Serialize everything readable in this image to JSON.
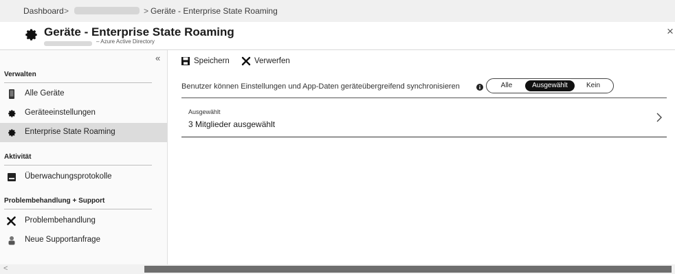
{
  "breadcrumb": {
    "dashboard": "Dashboard",
    "separator": ">",
    "current": "Geräte - Enterprise State Roaming"
  },
  "header": {
    "title": "Geräte - Enterprise State Roaming",
    "subtitle": "– Azure Active Directory",
    "icon": "gear-icon",
    "close": "×"
  },
  "sidebar": {
    "collapse": "«",
    "groups": [
      {
        "title": "Verwalten"
      },
      {
        "title": "Aktivität"
      },
      {
        "title": "Problembehandlung + Support"
      }
    ],
    "items": [
      {
        "label": "Alle Geräte",
        "icon": "device-icon"
      },
      {
        "label": "Geräteeinstellungen",
        "icon": "gear-icon"
      },
      {
        "label": "Enterprise State Roaming",
        "icon": "gear-icon",
        "active": true
      },
      {
        "label": "Überwachungsprotokolle",
        "icon": "log-icon"
      },
      {
        "label": "Problembehandlung",
        "icon": "tools-icon"
      },
      {
        "label": "Neue Supportanfrage",
        "icon": "support-person-icon"
      }
    ]
  },
  "toolbar": {
    "save_label": "Speichern",
    "discard_label": "Verwerfen"
  },
  "sync_setting": {
    "label": "Benutzer können Einstellungen und App-Daten geräteübergreifend synchronisieren",
    "options": [
      "Alle",
      "Ausgewählt",
      "Kein"
    ],
    "selected": "Ausgewählt"
  },
  "selected_members": {
    "caption": "Ausgewählt",
    "value": "3 Mitglieder ausgewählt"
  },
  "colors": {
    "accent": "#111111",
    "active_nav": "#dcdcdc",
    "scroll_thumb": "#6e6e6e"
  }
}
